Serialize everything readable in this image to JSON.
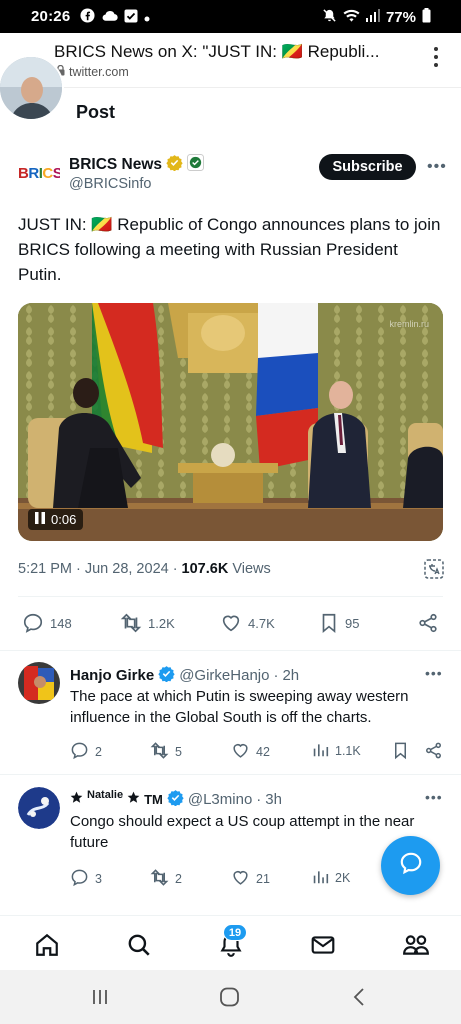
{
  "status_bar": {
    "time": "20:26",
    "battery": "77%"
  },
  "browser": {
    "page_title": "BRICS News on X: \"JUST IN: 🇨🇬 Republi...",
    "url": "twitter.com"
  },
  "page": {
    "heading": "Post"
  },
  "tweet": {
    "logo_text": "BRICS",
    "author_name": "BRICS News",
    "author_handle": "@BRICSinfo",
    "subscribe_label": "Subscribe",
    "text": "JUST IN: 🇨🇬 Republic of Congo announces plans to join BRICS following a meeting with Russian President Putin.",
    "media": {
      "duration": "0:06",
      "watermark": "kremlin.ru"
    },
    "time": "5:21 PM",
    "date": "Jun 28, 2024",
    "views_count": "107.6K",
    "views_label": "Views",
    "stats": {
      "replies": "148",
      "reposts": "1.2K",
      "likes": "4.7K",
      "bookmarks": "95"
    }
  },
  "replies": [
    {
      "name": "Hanjo Girke",
      "handle": "@GirkeHanjo",
      "age": "2h",
      "text": "The pace at which Putin is sweeping away western influence in the Global South is off the charts.",
      "replies": "2",
      "reposts": "5",
      "likes": "42",
      "views": "1.1K"
    },
    {
      "name_prefix": "Natalie",
      "name_suffix": "TM",
      "handle": "@L3mino",
      "age": "3h",
      "text": "Congo should expect a US coup attempt in the near future",
      "replies": "3",
      "reposts": "2",
      "likes": "21",
      "views": "2K"
    }
  ],
  "bottom_nav": {
    "notification_count": "19"
  },
  "colors": {
    "accent": "#1d9bf0",
    "verified_gold": "#e2b719",
    "text_secondary": "#536471"
  },
  "icons": [
    "facebook-icon",
    "cloud-icon",
    "check-square-icon",
    "mute-icon",
    "wifi-icon",
    "signal-icon",
    "battery-icon",
    "lock-icon",
    "kebab-icon",
    "verified-gold-icon",
    "affiliate-badge-icon",
    "more-icon",
    "play-pause-icon",
    "translate-icon",
    "reply-icon",
    "repost-icon",
    "like-icon",
    "bookmark-icon",
    "share-icon",
    "views-icon",
    "verified-blue-icon",
    "star-icon",
    "compose-message-icon",
    "home-icon",
    "search-icon",
    "notifications-icon",
    "messages-icon",
    "communities-icon",
    "recents-icon",
    "home-circle-icon",
    "back-icon"
  ]
}
